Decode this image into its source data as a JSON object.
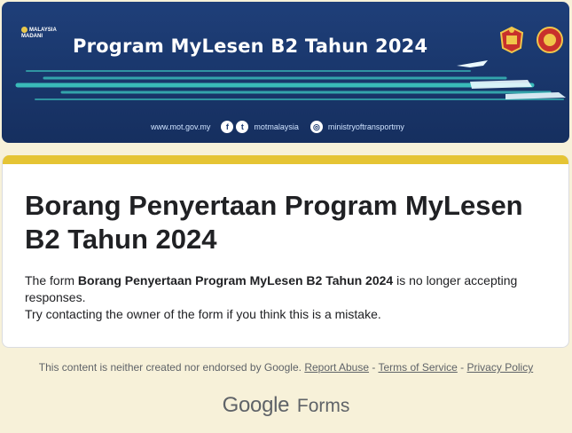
{
  "banner": {
    "logo_text": "MALAYSIA MADANI",
    "title": "Program MyLesen B2 Tahun 2024",
    "website": "www.mot.gov.my",
    "social_handle": "motmalaysia",
    "instagram_handle": "ministryoftransportmy"
  },
  "form": {
    "title": "Borang Penyertaan Program MyLesen B2 Tahun 2024",
    "msg_prefix": "The form ",
    "msg_form_name": "Borang Penyertaan Program MyLesen B2 Tahun 2024",
    "msg_suffix": " is no longer accepting responses.",
    "msg_line2": "Try contacting the owner of the form if you think this is a mistake."
  },
  "footer": {
    "disclaimer": "This content is neither created nor endorsed by Google.",
    "report_abuse": "Report Abuse",
    "terms": "Terms of Service",
    "privacy": "Privacy Policy",
    "sep": " - ",
    "brand_google": "Google",
    "brand_forms": "Forms"
  },
  "colors": {
    "accent": "#e5c434",
    "background": "#f7f1d9",
    "banner": "#1f3f79"
  }
}
